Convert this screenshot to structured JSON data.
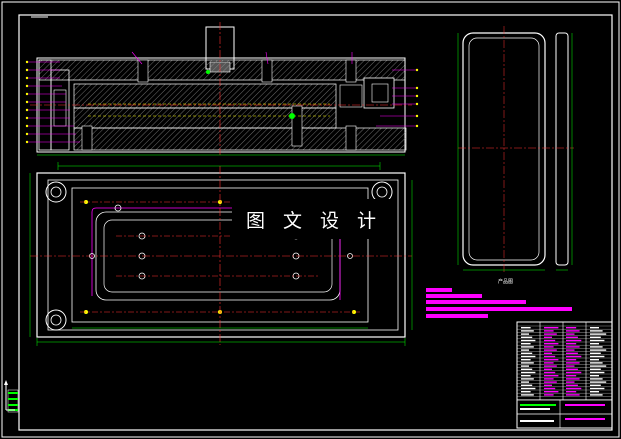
{
  "watermark": {
    "text": "图 文 设 计"
  },
  "labels": {
    "product_view": "产品图"
  },
  "colors": {
    "background": "#000000",
    "frame": "#ffffff",
    "mold_outline": "#ffffff",
    "hatch": "#b0b0b0",
    "dimension": "#00ff00",
    "center_line": "#ff3030",
    "leader": "#ff00ff",
    "hidden_line": "#ffff00",
    "cooling_channel": "#ff00ff",
    "notes_block": "#ff00ff",
    "title_block": "#ffffff"
  },
  "icons": {
    "ucs": "ucs-axis-icon"
  }
}
